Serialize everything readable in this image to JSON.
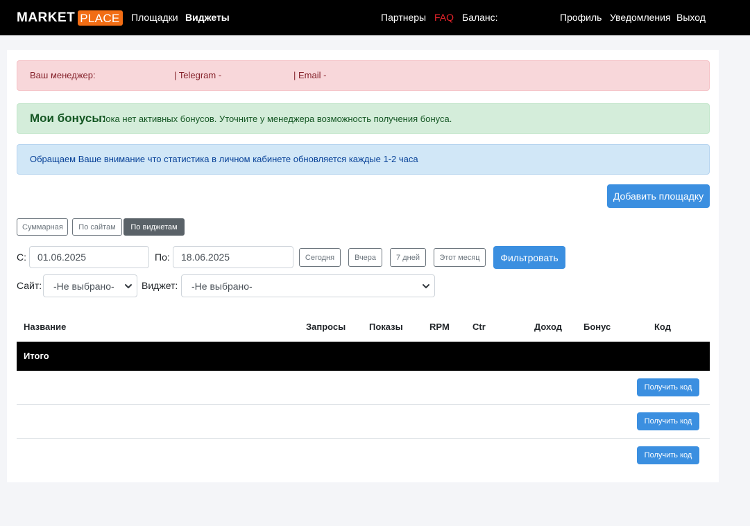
{
  "nav": {
    "logo_part1": "MARKET",
    "logo_part2": "PLACE",
    "links_left": [
      "Площадки",
      "Виджеты"
    ],
    "partners": "Партнеры",
    "faq": "FAQ",
    "balance_label": "Баланс:",
    "links_right": [
      "Профиль",
      "Уведомления",
      "Выход"
    ]
  },
  "manager_alert": {
    "manager_label": "Ваш менеджер:",
    "telegram_label": "| Telegram -",
    "email_label": "| Email -"
  },
  "bonus_alert": {
    "title": "Мои бонусы:",
    "text": "Пока нет активных бонусов. Уточните у менеджера возможность получения бонуса."
  },
  "info_alert": {
    "text": "Обращаем Ваше внимание что статистика в личном кабинете обновляется каждые 1-2 часа"
  },
  "add_site_button": "Добавить площадку",
  "view_tabs": [
    {
      "label": "Суммарная",
      "active": false
    },
    {
      "label": "По сайтам",
      "active": false
    },
    {
      "label": "По виджетам",
      "active": true
    }
  ],
  "filters": {
    "from_label": "С:",
    "from_value": "01.06.2025",
    "to_label": "По:",
    "to_value": "18.06.2025",
    "quick_buttons": [
      "Сегодня",
      "Вчера",
      "7 дней",
      "Этот месяц"
    ],
    "filter_button": "Фильтровать",
    "site_label": "Сайт:",
    "site_selected": "-Не выбрано-",
    "widget_label": "Виджет:",
    "widget_selected": "-Не выбрано-"
  },
  "table": {
    "columns": [
      "Название",
      "Запросы",
      "Показы",
      "RPM",
      "Ctr",
      "Доход",
      "Бонус",
      "Код"
    ],
    "total_label": "Итого",
    "rows": [
      {
        "action": "Получить код"
      },
      {
        "action": "Получить код"
      },
      {
        "action": "Получить код"
      }
    ]
  },
  "colors": {
    "accent": "#3b8fe0",
    "brand": "#f26d14",
    "faq": "#e8242b"
  }
}
